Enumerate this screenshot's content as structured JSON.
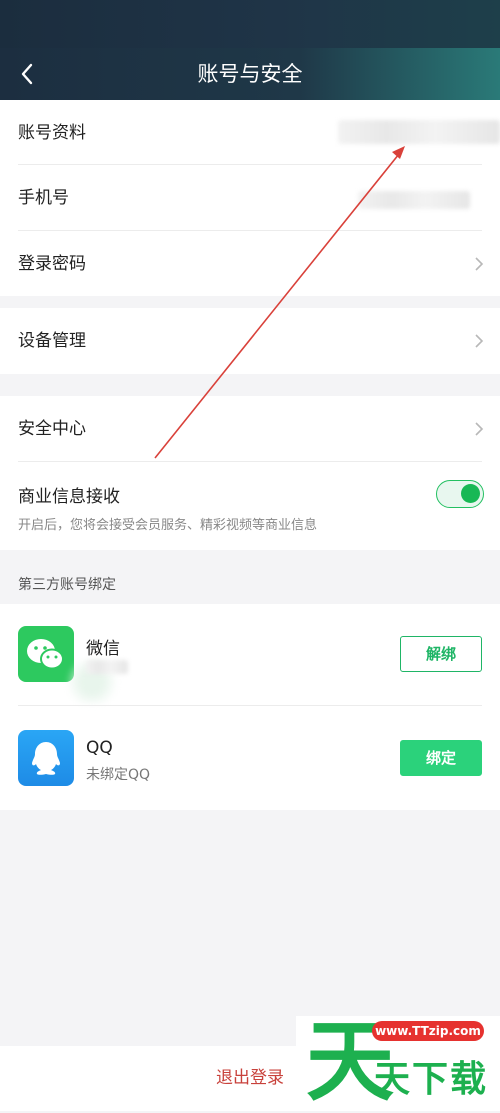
{
  "header": {
    "title": "账号与安全",
    "back_icon": "chevron-left-icon"
  },
  "account_section": {
    "items": [
      {
        "label": "账号资料"
      },
      {
        "label": "手机号"
      },
      {
        "label": "登录密码"
      }
    ]
  },
  "device_section": {
    "label": "设备管理"
  },
  "security_section": {
    "security_center": "安全中心",
    "business_info": {
      "label": "商业信息接收",
      "description": "开启后，您将会接受会员服务、精彩视频等商业信息",
      "enabled": true
    }
  },
  "third_party": {
    "title": "第三方账号绑定",
    "accounts": [
      {
        "name": "微信",
        "status": "",
        "button": "解绑",
        "icon": "wechat-icon"
      },
      {
        "name": "QQ",
        "status": "未绑定QQ",
        "button": "绑定",
        "icon": "qq-icon"
      }
    ]
  },
  "logout": "退出登录",
  "watermark": {
    "url": "www.TTzip.com",
    "text_big": "天",
    "text_rest": "天下载"
  },
  "colors": {
    "accent_green": "#1fb566",
    "logout_red": "#c8413b",
    "annotation_arrow": "#d9413a"
  }
}
